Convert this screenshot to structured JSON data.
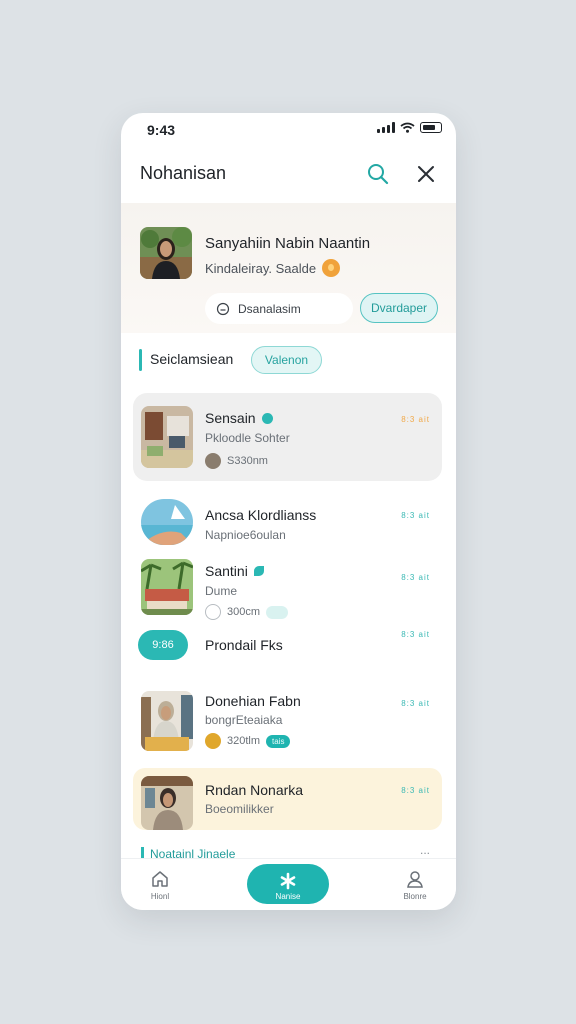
{
  "status": {
    "time": "9:43"
  },
  "header": {
    "title": "Nohanisan"
  },
  "profile": {
    "name": "Sanyahiin Nabin Naantin",
    "subtitle": "Kindaleiray. Saalde",
    "input_text": "Dsanalasim",
    "button_label": "Dvardaper"
  },
  "section": {
    "label": "Seiclamsiean",
    "tag": "Valenon"
  },
  "items": [
    {
      "title": "Sensain",
      "subtitle": "Pkloodle Sohter",
      "meta": "S330nm",
      "time": "8:3 ait"
    },
    {
      "title": "Ancsa Klordlianss",
      "subtitle": "Napnioe6oulan",
      "time": "8:3 ait"
    },
    {
      "title": "Santini",
      "subtitle": "Dume",
      "meta": "300cm",
      "time": "8:3 ait"
    },
    {
      "title": "Prondail Fks",
      "badge": "9:86",
      "time": "8:3 ait"
    },
    {
      "title": "Donehian Fabn",
      "subtitle": "bongrEteaiaka",
      "meta": "320tlm",
      "badge": "tais",
      "time": "8:3 ait"
    },
    {
      "title": "Rndan Nonarka",
      "subtitle": "Boeomilikker",
      "time": "8:3 ait"
    }
  ],
  "bottom_section": {
    "label": "Noatainl Jinaele",
    "more": "..."
  },
  "tabs": [
    {
      "label": "Hionl"
    },
    {
      "label": "Nanise"
    },
    {
      "label": "Blonre"
    }
  ],
  "colors": {
    "accent": "#1fb4b0",
    "highlight": "#fcf3dc"
  }
}
